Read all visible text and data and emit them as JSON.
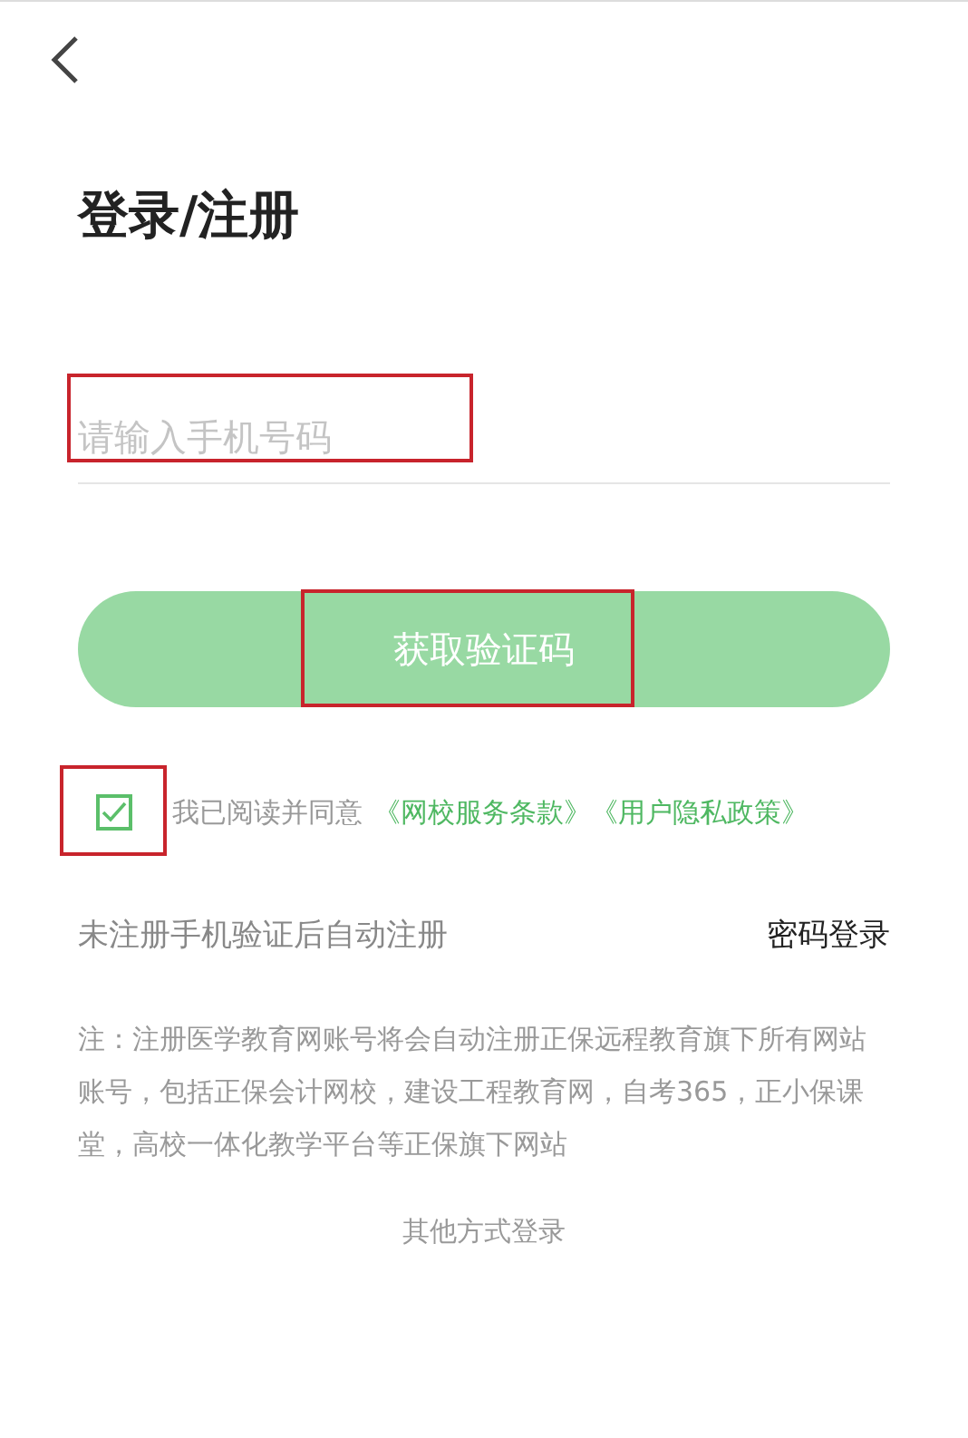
{
  "title": "登录/注册",
  "phone_field": {
    "placeholder": "请输入手机号码"
  },
  "get_code_button": {
    "label": "获取验证码",
    "disabled": true
  },
  "agreement": {
    "checked": true,
    "text": "我已阅读并同意",
    "links": [
      "《网校服务条款》",
      "《用户隐私政策》"
    ]
  },
  "auto_register_hint": "未注册手机验证后自动注册",
  "password_login": "密码登录",
  "note": "注：注册医学教育网账号将会自动注册正保远程教育旗下所有网站账号，包括正保会计网校，建设工程教育网，自考365，正小保课堂，高校一体化教学平台等正保旗下网站",
  "other_login": "其他方式登录"
}
